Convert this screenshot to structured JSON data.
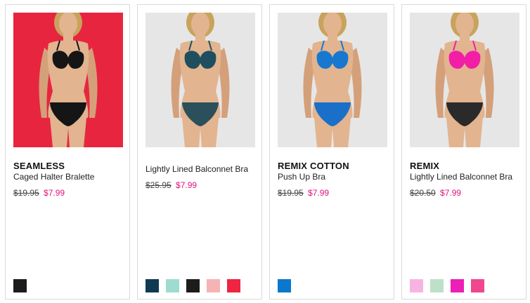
{
  "products": [
    {
      "title": "SEAMLESS",
      "subtitle": "Caged Halter Bralette",
      "old_price": "$19.95",
      "new_price": "$7.99",
      "swatches": [
        "#1c1c1c"
      ]
    },
    {
      "title": "",
      "subtitle": "Lightly Lined Balconnet Bra",
      "old_price": "$25.95",
      "new_price": "$7.99",
      "swatches": [
        "#0f3a52",
        "#9fdcd0",
        "#1c1c1c",
        "#f6b3b3",
        "#ee2440"
      ]
    },
    {
      "title": "REMIX COTTON",
      "subtitle": "Push Up Bra",
      "old_price": "$19.95",
      "new_price": "$7.99",
      "swatches": [
        "#0a78cc"
      ]
    },
    {
      "title": "REMIX",
      "subtitle": "Lightly Lined Balconnet Bra",
      "old_price": "$20.50",
      "new_price": "$7.99",
      "swatches": [
        "#f7b4e2",
        "#bde0c8",
        "#ec1fb6",
        "#f0468e"
      ]
    }
  ],
  "photos": [
    {
      "background": "#e8253f",
      "top_color": "#151515",
      "bottom_color": "#151515"
    },
    {
      "background": "#e6e6e6",
      "top_color": "#1f4f5e",
      "bottom_color": "#2c4f5c"
    },
    {
      "background": "#e6e6e6",
      "top_color": "#1878d0",
      "bottom_color": "#1a6fc9"
    },
    {
      "background": "#e6e6e6",
      "top_color": "#f21fa6",
      "bottom_color": "#2a2a2a"
    }
  ]
}
